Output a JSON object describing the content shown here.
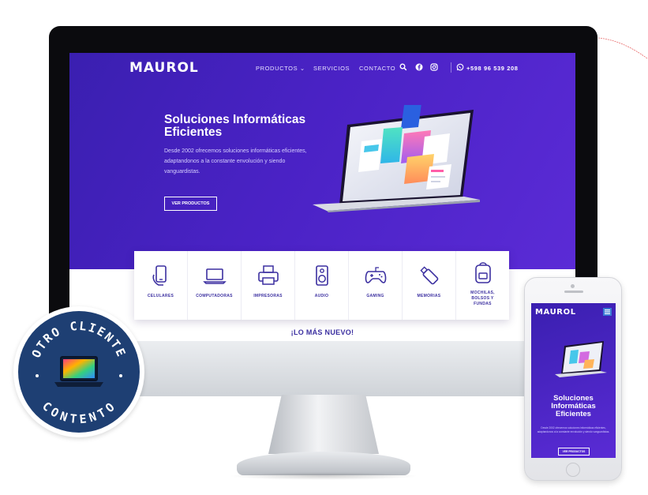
{
  "site": {
    "logo": "MAUROL",
    "nav": {
      "items": [
        {
          "label": "PRODUCTOS ⌄"
        },
        {
          "label": "SERVICIOS"
        },
        {
          "label": "CONTACTO"
        }
      ],
      "phone": "+598 96 539 208",
      "icons": [
        "search-icon",
        "facebook-icon",
        "instagram-icon",
        "whatsapp-icon"
      ]
    },
    "hero": {
      "title": "Soluciones Informáticas Eficientes",
      "text": "Desde 2002 ofrecemos soluciones informáticas eficientes, adaptandonos a la constante envolución y siendo vanguardistas.",
      "button": "VER PRODUCTOS"
    },
    "categories": [
      {
        "label": "CELULARES",
        "icon": "phone-hand-icon"
      },
      {
        "label": "COMPUTADORAS",
        "icon": "laptop-icon"
      },
      {
        "label": "IMPRESORAS",
        "icon": "printer-icon"
      },
      {
        "label": "AUDIO",
        "icon": "speaker-icon"
      },
      {
        "label": "GAMING",
        "icon": "gamepad-icon"
      },
      {
        "label": "MEMORIAS",
        "icon": "usb-icon"
      },
      {
        "label": "MOCHILAS,\nBOLSOS Y\nFUNDAS",
        "icon": "backpack-icon"
      }
    ],
    "section_title": "¡LO MÁS NUEVO!"
  },
  "badge": {
    "text_top": "OTRO CLIENTE",
    "text_bottom": "CONTENTO",
    "colors": {
      "background": "#1e3f73",
      "text": "#ffffff"
    }
  },
  "phone": {
    "logo": "MAUROL",
    "title": "Soluciones Informáticas Eficientes",
    "text": "Desde 2002 ofrecemos soluciones informáticas eficientes, adaptandonos a la constante envolución y siendo vanguardistas.",
    "button": "VER PRODUCTOS"
  },
  "colors": {
    "hero_start": "#3a1fb0",
    "hero_end": "#5b2bd6",
    "category_text": "#3b2fa0"
  }
}
